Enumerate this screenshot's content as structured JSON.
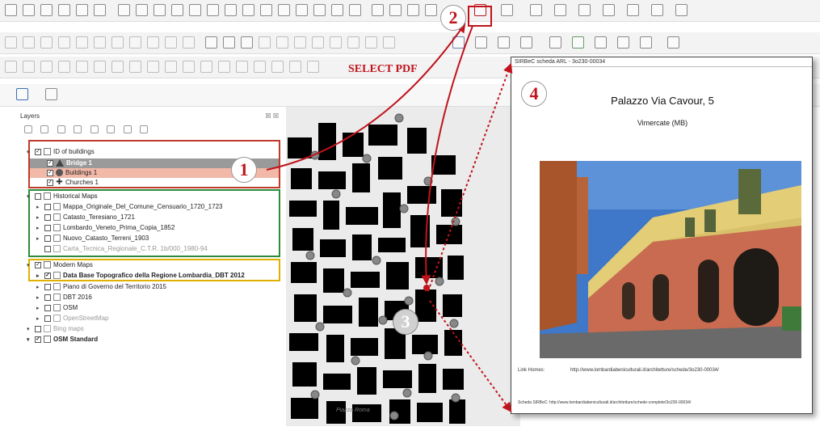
{
  "annotations": {
    "step1": "1",
    "step2": "2",
    "step3": "3",
    "step4": "4",
    "select_pdf": "SELECT PDF"
  },
  "layers_panel": {
    "title": "Layers",
    "header_buttons": "☒ ☒"
  },
  "layers": {
    "g1": {
      "name": "ID of buildings"
    },
    "g1_items": [
      {
        "name": "Bridge 1",
        "symbol": "triangle"
      },
      {
        "name": "Buildings 1",
        "symbol": "circle"
      },
      {
        "name": "Churches 1",
        "symbol": "cross"
      }
    ],
    "g2": {
      "name": "Historical Maps"
    },
    "g2_items": [
      {
        "name": "Mappa_Originale_Del_Comune_Censuario_1720_1723"
      },
      {
        "name": "Catasto_Teresiano_1721"
      },
      {
        "name": "Lombardo_Veneto_Prima_Copia_1852"
      },
      {
        "name": "Nuovo_Catasto_Terreni_1903"
      },
      {
        "name": "Carta_Tecnica_Regionale_C.T.R. 1b/000_1980-94"
      }
    ],
    "g3": {
      "name": "Modern Maps"
    },
    "g3_items": [
      {
        "name": "Data Base Topografico della Regione Lombardia_DBT 2012"
      },
      {
        "name": "Piano di Governo del Territorio 2015"
      },
      {
        "name": "DBT 2016"
      },
      {
        "name": "OSM"
      },
      {
        "name": "OpenStreetMap"
      }
    ],
    "bing": {
      "name": "Bing maps"
    },
    "osm_standard": {
      "name": "OSM Standard"
    }
  },
  "popup": {
    "window_title": "SIRBeC scheda ARL - 3o230-00034",
    "title": "Palazzo Via Cavour, 5",
    "subtitle": "Vimercate (MB)",
    "link_label": "Link Homes:",
    "link_url": "http://www.lombardiabeniculturali.it/architetture/schede/3o230-00034/",
    "footer": "Scheda SIRBeC: http://www.lombardiabeniculturali.it/architetture/schede-complete/3o230-00034/"
  },
  "map": {
    "street_label": "Piazza Roma"
  },
  "colors": {
    "annotation_red": "#c0141c",
    "group1_box": "#c0392b",
    "group2_box": "#2e8b3a",
    "group3_box": "#e0b000",
    "highlight_row": "#f2b8a8"
  }
}
